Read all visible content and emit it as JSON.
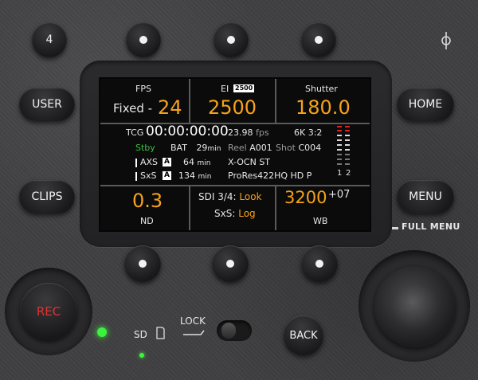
{
  "top_buttons": {
    "button_4_label": "4"
  },
  "side_buttons": {
    "user_label": "USER",
    "clips_label": "CLIPS",
    "home_label": "HOME",
    "menu_label": "MENU",
    "back_label": "BACK",
    "rec_label": "REC"
  },
  "full_menu_label": "FULL MENU",
  "lock_label": "LOCK",
  "sd_label": "SD",
  "screen": {
    "fps": {
      "title": "FPS",
      "mode": "Fixed -",
      "value": "24"
    },
    "ei": {
      "title": "EI",
      "badge": "2500",
      "value": "2500"
    },
    "shutter": {
      "title": "Shutter",
      "value": "180.0"
    },
    "tcg": "TCG",
    "timecode": "00:00:00:00",
    "frame_rate": "23.98",
    "fps_unit": "fps",
    "format": "6K 3:2",
    "status": "Stby",
    "bat_label": "BAT",
    "bat_value": "29",
    "bat_unit": "min",
    "reel_label": "Reel",
    "reel_value": "A001",
    "shot_label": "Shot",
    "shot_value": "C004",
    "axs_label": "AXS",
    "axs_slot": "A",
    "axs_time": "64",
    "axs_unit": "min",
    "sxs_label": "SxS",
    "sxs_slot": "A",
    "sxs_time": "134",
    "sxs_unit": "min",
    "ocn": "X-OCN ST",
    "codec": "ProRes422HQ HD P",
    "meter_ch1": "1",
    "meter_ch2": "2",
    "nd": {
      "value": "0.3",
      "label": "ND"
    },
    "sdi": {
      "label1": "SDI 3/4:",
      "value1": "Look",
      "label2": "SxS:",
      "value2": "Log"
    },
    "wb": {
      "value": "3200",
      "offset": "+07",
      "label": "WB"
    }
  }
}
